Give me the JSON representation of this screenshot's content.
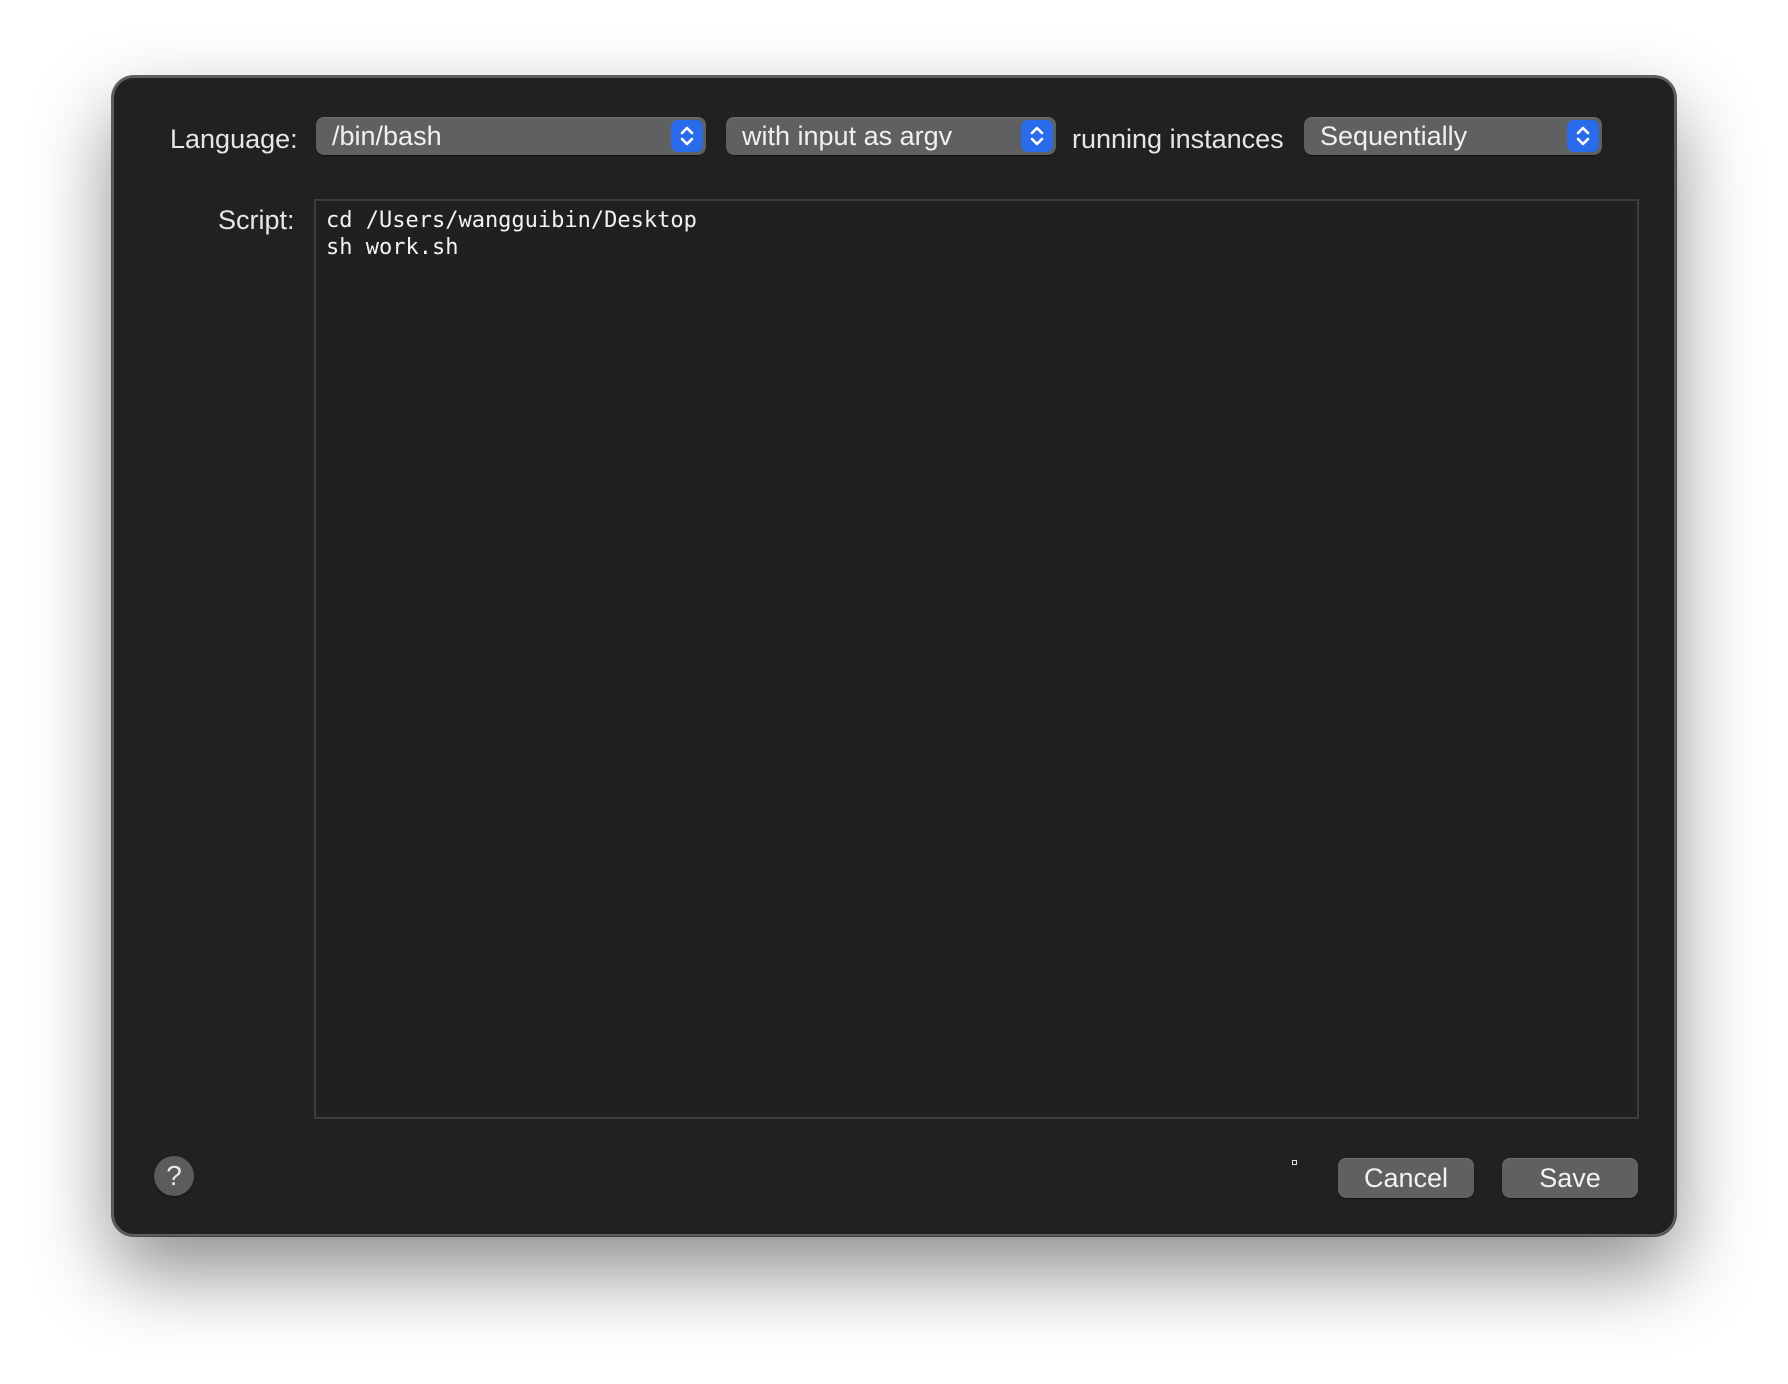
{
  "dialog": {
    "language_label": "Language:",
    "language_popup": {
      "value": "/bin/bash",
      "icon": "up-down-chevron-icon"
    },
    "input_popup": {
      "value": "with input as argv",
      "icon": "up-down-chevron-icon"
    },
    "running_label": "running instances",
    "sequence_popup": {
      "value": "Sequentially",
      "icon": "up-down-chevron-icon"
    },
    "script_label": "Script:",
    "script_lines": [
      "cd /Users/wangguibin/Desktop",
      "sh work.sh"
    ],
    "help_button": "?",
    "cancel_button": "Cancel",
    "save_button": "Save"
  },
  "colors": {
    "background": "#202122",
    "popup": "#5f6062",
    "accent": "#2a6bea"
  }
}
